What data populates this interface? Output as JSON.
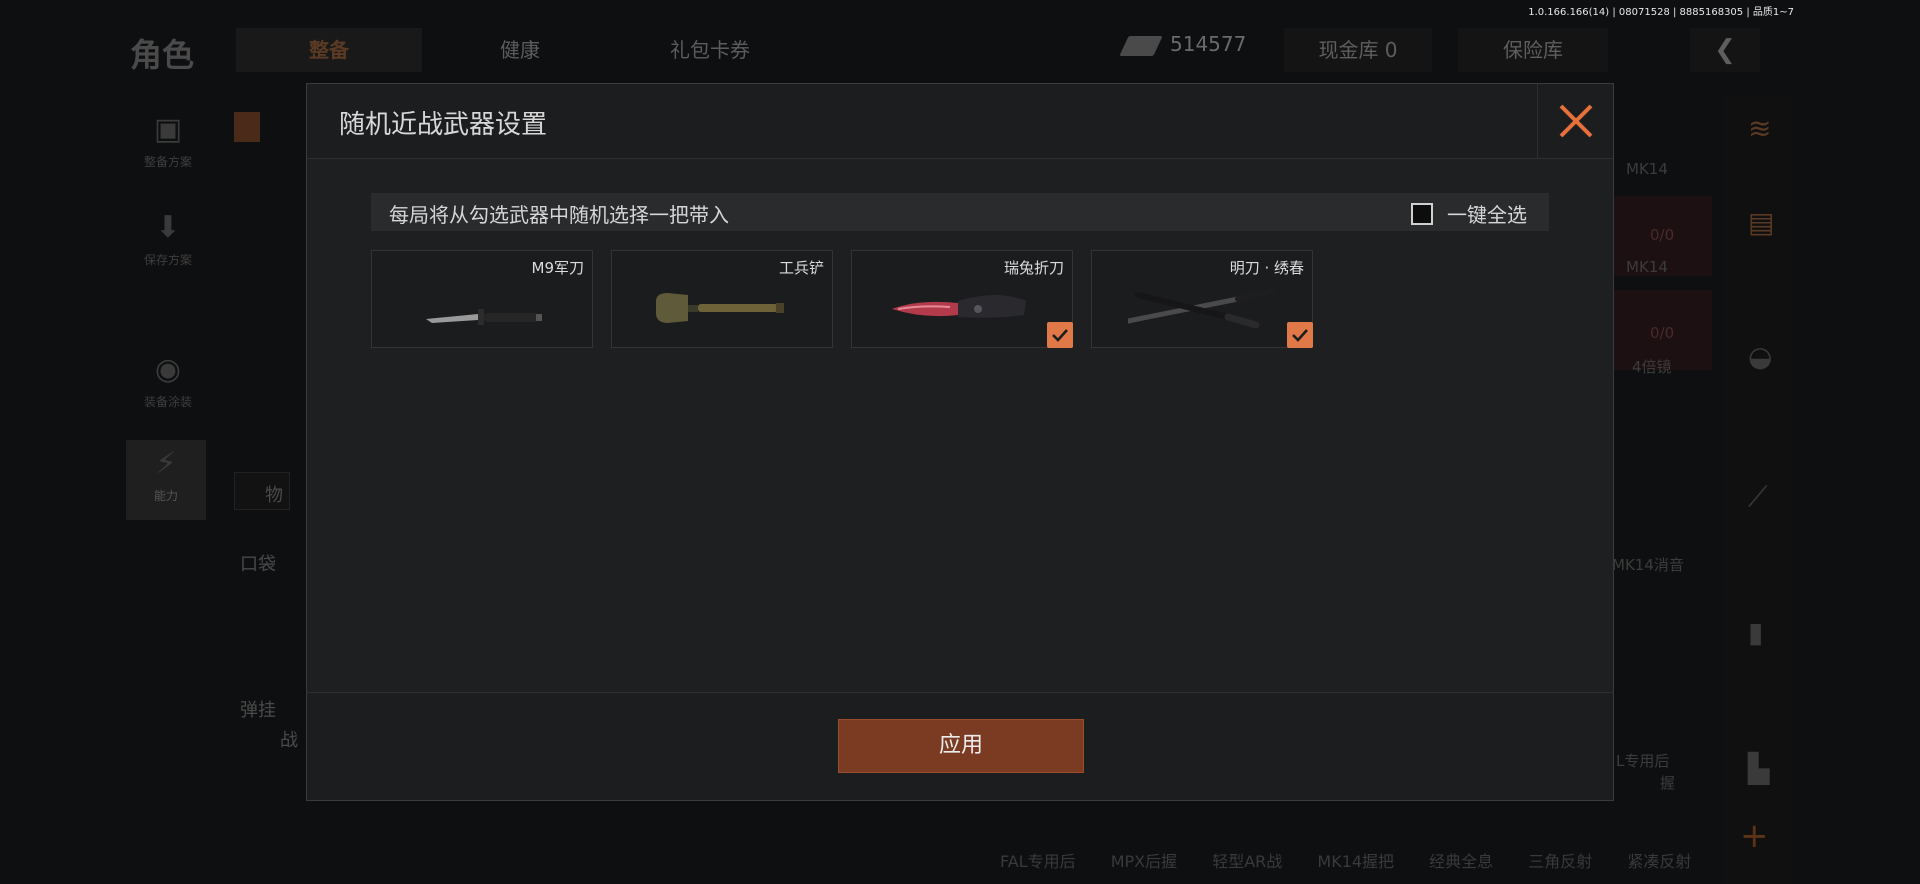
{
  "version_text": "1.0.166.166(14) | 08071528 | 8885168305 | 品质1~7",
  "background": {
    "title": "角色",
    "tabs": [
      "整备",
      "健康",
      "礼包卡券"
    ],
    "money": "514577",
    "cash_vault": "现金库 0",
    "safe_vault": "保险库",
    "sidebar": [
      {
        "label": "整备方案",
        "icon": "vest-icon"
      },
      {
        "label": "保存方案",
        "icon": "download-icon"
      },
      {
        "label": "装备涂装",
        "icon": "helmet-icon"
      },
      {
        "label": "能力",
        "icon": "ability-icon"
      }
    ],
    "labels": {
      "pocket": "口袋",
      "ammo": "弹挂",
      "items": "物",
      "combat": "战"
    },
    "right_labels": [
      "MK14",
      "0/0",
      "MK14",
      "0/0",
      "4倍镜",
      "MK14消音",
      "L专用后",
      "握"
    ],
    "bottom_labels": [
      "FAL专用后",
      "MPX后握",
      "轻型AR战",
      "MK14握把",
      "经典全息",
      "三角反射",
      "紧凑反射"
    ]
  },
  "modal": {
    "title": "随机近战武器设置",
    "description": "每局将从勾选武器中随机选择一把带入",
    "select_all_label": "一键全选",
    "select_all_checked": false,
    "weapons": [
      {
        "name": "M9军刀",
        "checked": false,
        "icon": "bayonet-icon"
      },
      {
        "name": "工兵铲",
        "checked": false,
        "icon": "shovel-icon"
      },
      {
        "name": "瑞兔折刀",
        "checked": true,
        "icon": "folding-knife-icon"
      },
      {
        "name": "明刀 · 绣春",
        "checked": true,
        "icon": "sword-icon"
      }
    ],
    "apply_label": "应用"
  },
  "colors": {
    "accent": "#e07848",
    "apply_button": "#7a3b22",
    "close_icon": "#e8703a"
  }
}
